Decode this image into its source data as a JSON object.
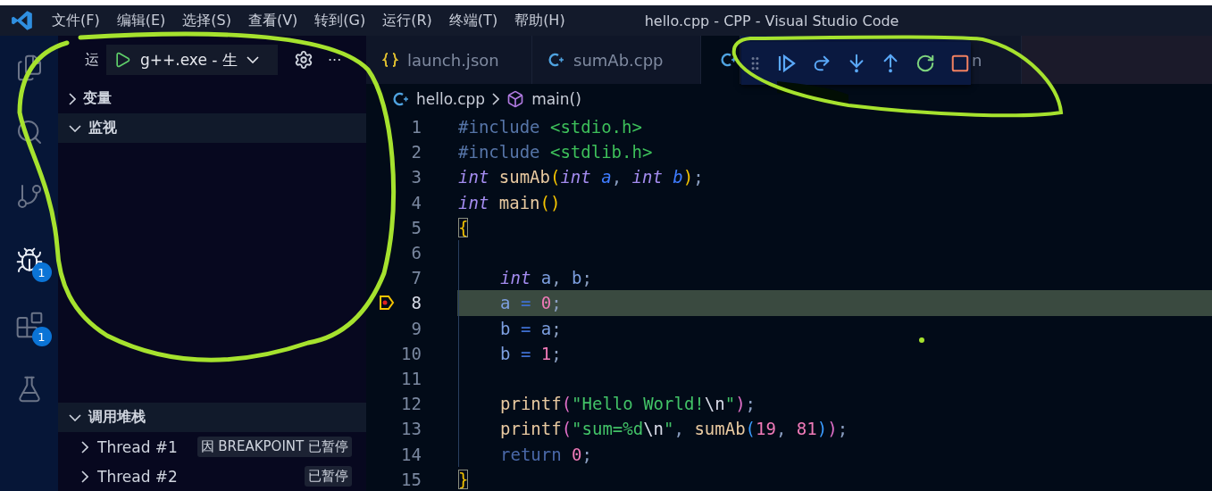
{
  "menu": [
    "文件(F)",
    "编辑(E)",
    "选择(S)",
    "查看(V)",
    "转到(G)",
    "运行(R)",
    "终端(T)",
    "帮助(H)"
  ],
  "window": {
    "title": "hello.cpp - CPP - Visual Studio Code"
  },
  "activity_bar": [
    {
      "kind": "explorer",
      "selected": false
    },
    {
      "kind": "search",
      "selected": false
    },
    {
      "kind": "source-control",
      "selected": false
    },
    {
      "kind": "run-debug",
      "selected": true,
      "badge": "1"
    },
    {
      "kind": "extensions",
      "selected": false,
      "badge": "1"
    },
    {
      "kind": "testing",
      "selected": false
    }
  ],
  "sidebar": {
    "title": "运",
    "run_config": "g++.exe - 生",
    "more": "···",
    "sections": [
      {
        "label": "变量",
        "expanded": false
      },
      {
        "label": "监视",
        "expanded": true
      }
    ],
    "call_stack": {
      "label": "调用堆栈",
      "expanded": true,
      "threads": [
        {
          "name": "Thread #1",
          "status": "因 BREAKPOINT 已暂停"
        },
        {
          "name": "Thread #2",
          "status": "已暂停"
        }
      ]
    }
  },
  "tabs": [
    {
      "kind": "json",
      "label": "launch.json",
      "selected": false
    },
    {
      "kind": "cpp",
      "label": "sumAb.cpp",
      "selected": false
    },
    {
      "kind": "cpp",
      "selected": true
    },
    {
      "kind": "text",
      "label": "n",
      "selected": false
    }
  ],
  "debug_toolbar": [
    {
      "kind": "continue"
    },
    {
      "kind": "step-over"
    },
    {
      "kind": "step-into"
    },
    {
      "kind": "step-out"
    },
    {
      "kind": "restart"
    },
    {
      "kind": "stop"
    }
  ],
  "breadcrumb": {
    "file": "hello.cpp",
    "symbol": "main()"
  },
  "code": [
    {
      "number": "1",
      "current": false,
      "indented": false,
      "tokens": [
        {
          "kind": "preproc",
          "t": "#include "
        },
        {
          "kind": "header",
          "t": "<stdio.h>"
        }
      ]
    },
    {
      "number": "2",
      "current": false,
      "indented": false,
      "tokens": [
        {
          "kind": "preproc",
          "t": "#include "
        },
        {
          "kind": "header",
          "t": "<stdlib.h>"
        }
      ]
    },
    {
      "number": "3",
      "current": false,
      "indented": false,
      "tokens": [
        {
          "kind": "keyword",
          "t": "int"
        },
        {
          "kind": "function",
          "t": " sumAb"
        },
        {
          "kind": "paren",
          "t": "("
        },
        {
          "kind": "keyword",
          "t": "int"
        },
        {
          "kind": "param",
          "t": " a"
        },
        {
          "kind": "punct",
          "t": ", "
        },
        {
          "kind": "keyword",
          "t": "int"
        },
        {
          "kind": "param",
          "t": " b"
        },
        {
          "kind": "paren",
          "t": ")"
        },
        {
          "kind": "punct",
          "t": ";"
        }
      ]
    },
    {
      "number": "4",
      "current": false,
      "indented": false,
      "tokens": [
        {
          "kind": "keyword",
          "t": "int"
        },
        {
          "kind": "function",
          "t": " main"
        },
        {
          "kind": "paren",
          "t": "()"
        }
      ]
    },
    {
      "number": "5",
      "current": false,
      "indented": false,
      "tokens": [
        {
          "kind": "brace",
          "t": "{"
        }
      ]
    },
    {
      "number": "6",
      "current": false,
      "indented": true
    },
    {
      "number": "7",
      "current": false,
      "indented": true,
      "tokens": [
        {
          "kind": "keyword",
          "t": "int"
        },
        {
          "kind": "var",
          "t": " a"
        },
        {
          "kind": "punct",
          "t": ", "
        },
        {
          "kind": "var",
          "t": "b"
        },
        {
          "kind": "punct",
          "t": ";"
        }
      ]
    },
    {
      "number": "8",
      "current": true,
      "indented": true,
      "tokens": [
        {
          "kind": "var",
          "t": "a"
        },
        {
          "kind": "op",
          "t": " = "
        },
        {
          "kind": "number",
          "t": "0"
        },
        {
          "kind": "punct",
          "t": ";"
        }
      ]
    },
    {
      "number": "9",
      "current": false,
      "indented": true,
      "tokens": [
        {
          "kind": "var",
          "t": "b"
        },
        {
          "kind": "op",
          "t": " = "
        },
        {
          "kind": "var",
          "t": "a"
        },
        {
          "kind": "punct",
          "t": ";"
        }
      ]
    },
    {
      "number": "10",
      "current": false,
      "indented": true,
      "tokens": [
        {
          "kind": "var",
          "t": "b"
        },
        {
          "kind": "op",
          "t": " = "
        },
        {
          "kind": "number",
          "t": "1"
        },
        {
          "kind": "punct",
          "t": ";"
        }
      ]
    },
    {
      "number": "11",
      "current": false,
      "indented": true
    },
    {
      "number": "12",
      "current": false,
      "indented": true,
      "tokens": [
        {
          "kind": "function",
          "t": "printf"
        },
        {
          "kind": "paren2",
          "t": "("
        },
        {
          "kind": "string",
          "t": "\"Hello World!"
        },
        {
          "kind": "escape",
          "t": "\\n"
        },
        {
          "kind": "string",
          "t": "\""
        },
        {
          "kind": "paren2",
          "t": ")"
        },
        {
          "kind": "punct",
          "t": ";"
        }
      ]
    },
    {
      "number": "13",
      "current": false,
      "indented": true,
      "tokens": [
        {
          "kind": "function",
          "t": "printf"
        },
        {
          "kind": "paren2",
          "t": "("
        },
        {
          "kind": "string",
          "t": "\"sum=%d"
        },
        {
          "kind": "escape",
          "t": "\\n"
        },
        {
          "kind": "string",
          "t": "\""
        },
        {
          "kind": "punct",
          "t": ", "
        },
        {
          "kind": "function",
          "t": "sumAb"
        },
        {
          "kind": "paren3",
          "t": "("
        },
        {
          "kind": "number",
          "t": "19"
        },
        {
          "kind": "punct",
          "t": ", "
        },
        {
          "kind": "number",
          "t": "81"
        },
        {
          "kind": "paren3",
          "t": ")"
        },
        {
          "kind": "paren2",
          "t": ")"
        },
        {
          "kind": "punct",
          "t": ";"
        }
      ]
    },
    {
      "number": "14",
      "current": false,
      "indented": true,
      "tokens": [
        {
          "kind": "control",
          "t": "return "
        },
        {
          "kind": "number",
          "t": "0"
        },
        {
          "kind": "punct",
          "t": ";"
        }
      ]
    },
    {
      "number": "15",
      "current": false,
      "indented": false,
      "tokens": [
        {
          "kind": "brace",
          "t": "}"
        }
      ]
    }
  ]
}
